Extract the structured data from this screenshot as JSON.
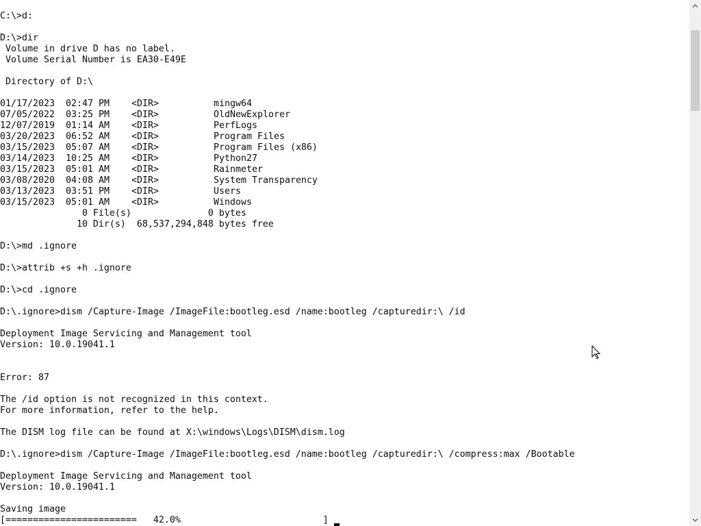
{
  "colors": {
    "background": "#ffffff",
    "foreground": "#0c0c0c",
    "scrollbar_track": "#f0f0f0",
    "scrollbar_thumb": "#cdcdcd",
    "scrollbar_arrow": "#606060"
  },
  "icons": {
    "scroll_up": "chevron-up-icon",
    "scroll_down": "chevron-down-icon",
    "mouse_pointer": "arrow-pointer-icon",
    "text_cursor": "text-cursor"
  },
  "console": {
    "drive_switch": {
      "prompt": "C:\\>",
      "command": "d:"
    },
    "dir": {
      "prompt": "D:\\>",
      "command": "dir",
      "volume_label": " Volume in drive D has no label.",
      "serial_number": " Volume Serial Number is EA30-E49E",
      "directory_of": " Directory of D:\\",
      "entries": [
        {
          "date": "01/17/2023",
          "time": "02:47 PM",
          "type": "<DIR>",
          "name": "mingw64"
        },
        {
          "date": "07/05/2022",
          "time": "03:25 PM",
          "type": "<DIR>",
          "name": "OldNewExplorer"
        },
        {
          "date": "12/07/2019",
          "time": "01:14 AM",
          "type": "<DIR>",
          "name": "PerfLogs"
        },
        {
          "date": "03/20/2023",
          "time": "06:52 AM",
          "type": "<DIR>",
          "name": "Program Files"
        },
        {
          "date": "03/15/2023",
          "time": "05:07 AM",
          "type": "<DIR>",
          "name": "Program Files (x86)"
        },
        {
          "date": "03/14/2023",
          "time": "10:25 AM",
          "type": "<DIR>",
          "name": "Python27"
        },
        {
          "date": "03/15/2023",
          "time": "05:01 AM",
          "type": "<DIR>",
          "name": "Rainmeter"
        },
        {
          "date": "03/08/2020",
          "time": "04:08 AM",
          "type": "<DIR>",
          "name": "System Transparency"
        },
        {
          "date": "03/13/2023",
          "time": "03:51 PM",
          "type": "<DIR>",
          "name": "Users"
        },
        {
          "date": "03/15/2023",
          "time": "05:01 AM",
          "type": "<DIR>",
          "name": "Windows"
        }
      ],
      "files_summary": "               0 File(s)              0 bytes",
      "dirs_summary": "              10 Dir(s)  68,537,294,848 bytes free"
    },
    "md": {
      "prompt": "D:\\>",
      "command": "md .ignore"
    },
    "attrib": {
      "prompt": "D:\\>",
      "command": "attrib +s +h .ignore"
    },
    "cd": {
      "prompt": "D:\\>",
      "command": "cd .ignore"
    },
    "dism_attempt_1": {
      "prompt": "D:\\.ignore>",
      "command": "dism /Capture-Image /ImageFile:bootleg.esd /name:bootleg /capturedir:\\ /id",
      "tool_name": "Deployment Image Servicing and Management tool",
      "version": "Version: 10.0.19041.1",
      "error": "Error: 87",
      "error_message": "The /id option is not recognized in this context.",
      "help_hint": "For more information, refer to the help.",
      "log_path": "The DISM log file can be found at X:\\windows\\Logs\\DISM\\dism.log"
    },
    "dism_attempt_2": {
      "prompt": "D:\\.ignore>",
      "command": "dism /Capture-Image /ImageFile:bootleg.esd /name:bootleg /capturedir:\\ /compress:max /Bootable",
      "tool_name": "Deployment Image Servicing and Management tool",
      "version": "Version: 10.0.19041.1",
      "status": "Saving image",
      "progress_bar": "[========================   42.0%                          ]"
    }
  }
}
